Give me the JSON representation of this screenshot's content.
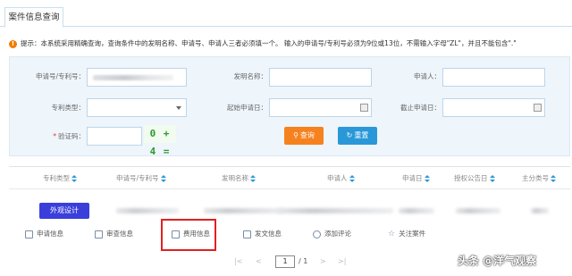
{
  "tab": {
    "title": "案件信息查询"
  },
  "notice": {
    "text": "提示：本系统采用精确查询，查询条件中的发明名称、申请号、申请人三者必须填一个。 输入的申请号/专利号必须为9位或13位，不需输入字母\"ZL\"，并且不能包含\".\""
  },
  "form": {
    "application_no_label": "申请号/专利号：",
    "invention_name_label": "发明名称：",
    "applicant_label": "申请人：",
    "patent_type_label": "专利类型：",
    "start_date_label": "起始申请日：",
    "end_date_label": "截止申请日：",
    "captcha_label": "验证码：",
    "captcha_text": "0 + 4 =",
    "search_label": "查询",
    "reset_label": "重置"
  },
  "table": {
    "headers": [
      "专利类型",
      "申请号/专利号",
      "发明名称",
      "申请人",
      "申请日",
      "授权公告日",
      "主分类号"
    ],
    "row": {
      "type_badge": "外观设计"
    },
    "actions": [
      "申请信息",
      "审查信息",
      "费用信息",
      "发文信息",
      "添加评论",
      "关注案件"
    ]
  },
  "pager": {
    "current": "1",
    "total": "/ 1"
  },
  "watermark": {
    "text": "头条 @洋气观察"
  },
  "colors": {
    "accent_blue": "#2a98d8",
    "search_orange": "#f5821f",
    "badge_blue": "#3a3fdc",
    "highlight_red": "#e02020"
  }
}
